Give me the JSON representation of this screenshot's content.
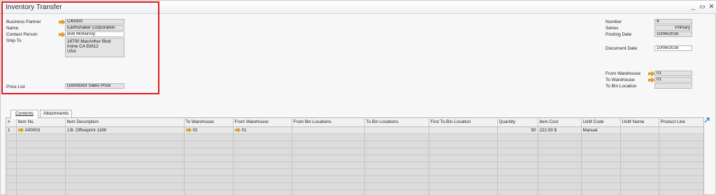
{
  "window": {
    "title": "Inventory Transfer",
    "controls": [
      "minimize",
      "restore",
      "close"
    ]
  },
  "header_left": {
    "business_partner": {
      "label": "Business Partner",
      "value": "C40000"
    },
    "name": {
      "label": "Name",
      "value": "Earthshaker Corporation"
    },
    "contact_person": {
      "label": "Contact Person",
      "value": "Bob McKensly"
    },
    "ship_to": {
      "label": "Ship To",
      "lines": [
        "18700 MacArthur Blvd",
        "Irvine CA  92612",
        "USA"
      ]
    },
    "price_list": {
      "label": "Price List",
      "value": "Distributor Sales Price"
    }
  },
  "header_right": {
    "number": {
      "label": "Number",
      "value": "4"
    },
    "series": {
      "label": "Series",
      "value": "Primary"
    },
    "posting_date": {
      "label": "Posting Date",
      "value": "10/06/2016"
    },
    "document_date": {
      "label": "Document Date",
      "value": "10/06/2016"
    },
    "from_warehouse": {
      "label": "From Warehouse",
      "value": "01"
    },
    "to_warehouse": {
      "label": "To Warehouse",
      "value": "01"
    },
    "to_bin_location": {
      "label": "To Bin Location",
      "value": ""
    }
  },
  "tabs": [
    {
      "label": "Contents",
      "active": true
    },
    {
      "label": "Attachments",
      "active": false
    }
  ],
  "grid": {
    "columns": [
      "#",
      "Item No.",
      "Item Description",
      "To Warehouse",
      "From Warehouse",
      "From Bin Locations",
      "To Bin Locations",
      "First To-Bin-Location",
      "Quantity",
      "Item Cost",
      "UoM Code",
      "UoM Name",
      "Product Line"
    ],
    "rows": [
      {
        "n": "1",
        "item_no": "A00003",
        "description": "J.B. Officeprint 1186",
        "to_wh": "02",
        "from_wh": "01",
        "from_bin": "",
        "to_bin": "",
        "first_bin": "",
        "quantity": "50",
        "cost": "222.93 $",
        "uom_code": "Manual",
        "uom_name": "",
        "product_line": ""
      }
    ],
    "empty_rows": 10
  },
  "colors": {
    "highlight_box": "#e1191f",
    "link_arrow": "#e8a317"
  },
  "icons": [
    "link-arrow-icon",
    "expand-grid-icon"
  ]
}
